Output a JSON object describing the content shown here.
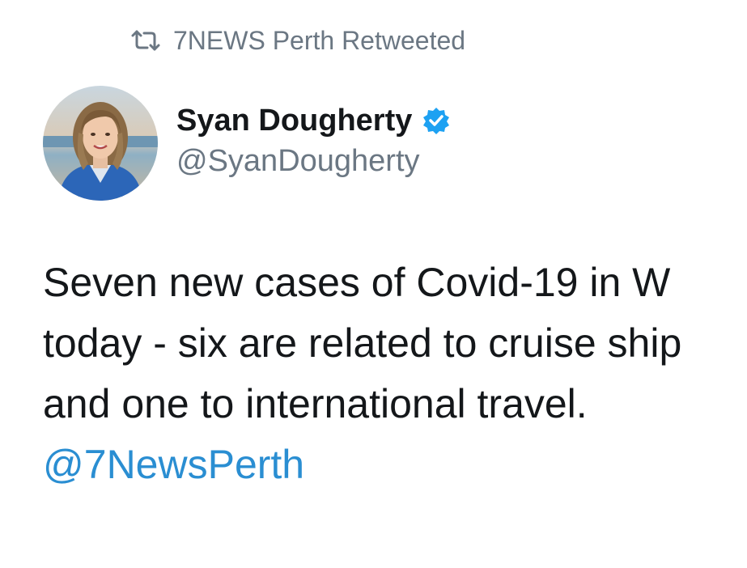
{
  "retweet": {
    "icon": "retweet-icon",
    "text": "7NEWS Perth Retweeted"
  },
  "author": {
    "avatar": "avatar",
    "display_name": "Syan Dougherty",
    "verified_icon": "verified-badge-icon",
    "handle": "@SyanDougherty"
  },
  "tweet": {
    "lines": [
      "Seven new cases of Covid-19 in W",
      "today - six are related to cruise ship",
      "and one to international travel."
    ],
    "mention": "@7NewsPerth"
  },
  "colors": {
    "secondary_text": "#6b7783",
    "primary_text": "#14171a",
    "link": "#2a8ed2",
    "verified": "#1da1f2"
  }
}
